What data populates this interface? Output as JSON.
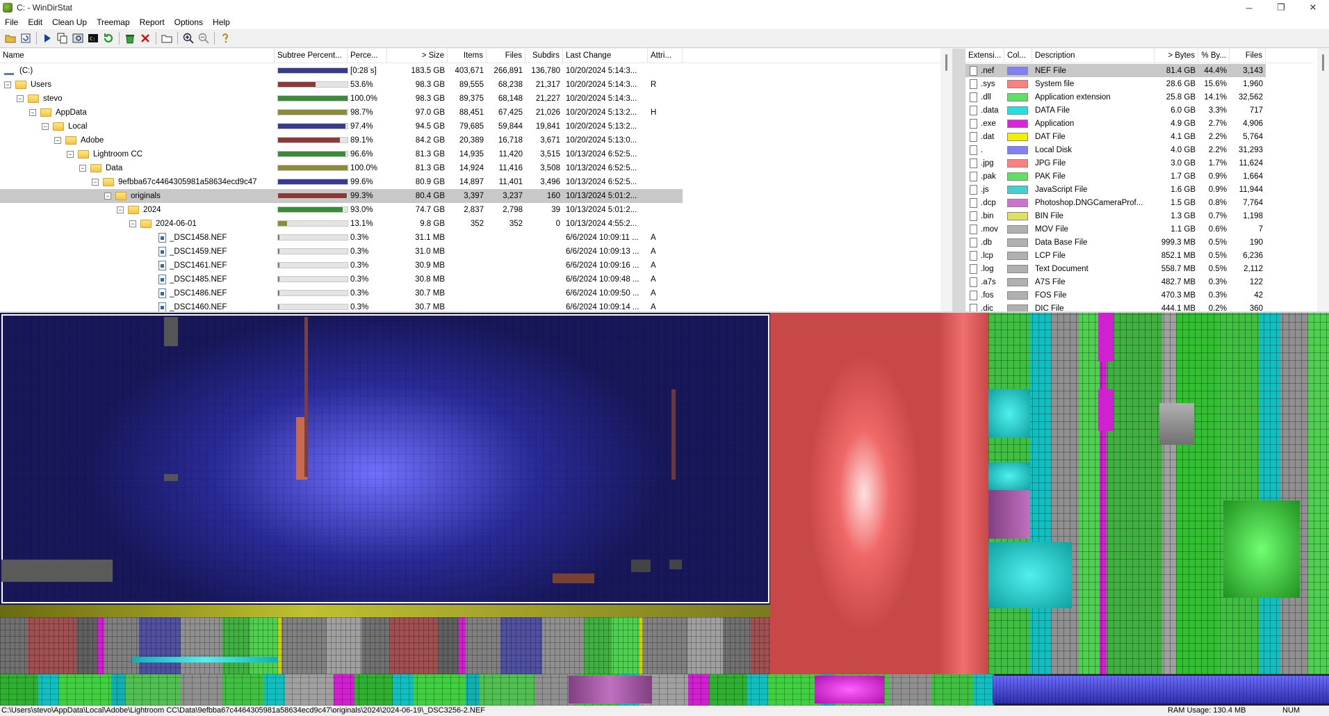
{
  "window": {
    "title": "C: - WinDirStat",
    "min": "─",
    "max": "❐",
    "close": "✕"
  },
  "menu": [
    "File",
    "Edit",
    "Clean Up",
    "Treemap",
    "Report",
    "Options",
    "Help"
  ],
  "toolbar_icons": [
    "open-icon",
    "refresh-icon",
    "play-icon",
    "copy-icon",
    "explorer-icon",
    "cmd-icon",
    "refresh-all-icon",
    "recycle-icon",
    "delete-icon",
    "folder-icon",
    "zoom-in-icon",
    "zoom-out-icon",
    "help-icon"
  ],
  "tree": {
    "headers": [
      "Name",
      "Subtree Percent...",
      "Perce...",
      "> Size",
      "Items",
      "Files",
      "Subdirs",
      "Last Change",
      "Attri..."
    ],
    "rows": [
      {
        "name": "(C:)",
        "depth": 0,
        "icon": "drive",
        "expander": "",
        "pct_fill": 1.0,
        "bar_color": "#3b3b8e",
        "percent": "[0:28 s]",
        "size": "183.5 GB",
        "items": "403,671",
        "files": "266,891",
        "subdirs": "136,780",
        "last_change": "10/20/2024  5:14:3...",
        "attr": ""
      },
      {
        "name": "Users",
        "depth": 0,
        "icon": "folder",
        "expander": "−",
        "pct_fill": 0.536,
        "bar_color": "#8b3a3a",
        "percent": "53.6%",
        "size": "98.3 GB",
        "items": "89,555",
        "files": "68,238",
        "subdirs": "21,317",
        "last_change": "10/20/2024  5:14:3...",
        "attr": "R"
      },
      {
        "name": "stevo",
        "depth": 1,
        "icon": "folder",
        "expander": "−",
        "pct_fill": 1.0,
        "bar_color": "#3a8b3a",
        "percent": "100.0%",
        "size": "98.3 GB",
        "items": "89,375",
        "files": "68,148",
        "subdirs": "21,227",
        "last_change": "10/20/2024  5:14:3...",
        "attr": ""
      },
      {
        "name": "AppData",
        "depth": 2,
        "icon": "folder",
        "expander": "−",
        "pct_fill": 0.987,
        "bar_color": "#8b8b3a",
        "percent": "98.7%",
        "size": "97.0 GB",
        "items": "88,451",
        "files": "67,425",
        "subdirs": "21,026",
        "last_change": "10/20/2024  5:13:2...",
        "attr": "H"
      },
      {
        "name": "Local",
        "depth": 3,
        "icon": "folder",
        "expander": "−",
        "pct_fill": 0.974,
        "bar_color": "#3b3b8e",
        "percent": "97.4%",
        "size": "94.5 GB",
        "items": "79,685",
        "files": "59,844",
        "subdirs": "19,841",
        "last_change": "10/20/2024  5:13:2...",
        "attr": ""
      },
      {
        "name": "Adobe",
        "depth": 4,
        "icon": "folder",
        "expander": "−",
        "pct_fill": 0.891,
        "bar_color": "#8b3a3a",
        "percent": "89.1%",
        "size": "84.2 GB",
        "items": "20,389",
        "files": "16,718",
        "subdirs": "3,671",
        "last_change": "10/20/2024  5:13:0...",
        "attr": ""
      },
      {
        "name": "Lightroom CC",
        "depth": 5,
        "icon": "folder",
        "expander": "−",
        "pct_fill": 0.966,
        "bar_color": "#3a8b3a",
        "percent": "96.6%",
        "size": "81.3 GB",
        "items": "14,935",
        "files": "11,420",
        "subdirs": "3,515",
        "last_change": "10/13/2024  6:52:5...",
        "attr": ""
      },
      {
        "name": "Data",
        "depth": 6,
        "icon": "folder",
        "expander": "−",
        "pct_fill": 1.0,
        "bar_color": "#8b8b3a",
        "percent": "100.0%",
        "size": "81.3 GB",
        "items": "14,924",
        "files": "11,416",
        "subdirs": "3,508",
        "last_change": "10/13/2024  6:52:5...",
        "attr": ""
      },
      {
        "name": "9efbba67c4464305981a58634ecd9c47",
        "depth": 7,
        "icon": "folder",
        "expander": "−",
        "pct_fill": 0.996,
        "bar_color": "#3b3b8e",
        "percent": "99.6%",
        "size": "80.9 GB",
        "items": "14,897",
        "files": "11,401",
        "subdirs": "3,496",
        "last_change": "10/13/2024  6:52:5...",
        "attr": ""
      },
      {
        "name": "originals",
        "depth": 8,
        "icon": "folder",
        "expander": "−",
        "pct_fill": 0.993,
        "bar_color": "#8b3a3a",
        "percent": "99.3%",
        "size": "80.4 GB",
        "items": "3,397",
        "files": "3,237",
        "subdirs": "160",
        "last_change": "10/13/2024  5:01:2...",
        "attr": "",
        "selected": true
      },
      {
        "name": "2024",
        "depth": 9,
        "icon": "folder",
        "expander": "−",
        "pct_fill": 0.93,
        "bar_color": "#3a8b3a",
        "percent": "93.0%",
        "size": "74.7 GB",
        "items": "2,837",
        "files": "2,798",
        "subdirs": "39",
        "last_change": "10/13/2024  5:01:2...",
        "attr": ""
      },
      {
        "name": "2024-06-01",
        "depth": 10,
        "icon": "folder",
        "expander": "−",
        "pct_fill": 0.131,
        "bar_color": "#8b8b3a",
        "percent": "13.1%",
        "size": "9.8 GB",
        "items": "352",
        "files": "352",
        "subdirs": "0",
        "last_change": "10/13/2024  4:55:2...",
        "attr": ""
      },
      {
        "name": "_DSC1458.NEF",
        "depth": 11,
        "icon": "file",
        "expander": "",
        "pct_fill": 0.003,
        "bar_color": "#777",
        "percent": "0.3%",
        "size": "31.1 MB",
        "items": "",
        "files": "",
        "subdirs": "",
        "last_change": "6/6/2024  10:09:11 ...",
        "attr": "A"
      },
      {
        "name": "_DSC1459.NEF",
        "depth": 11,
        "icon": "file",
        "expander": "",
        "pct_fill": 0.003,
        "bar_color": "#777",
        "percent": "0.3%",
        "size": "31.0 MB",
        "items": "",
        "files": "",
        "subdirs": "",
        "last_change": "6/6/2024  10:09:13 ...",
        "attr": "A"
      },
      {
        "name": "_DSC1461.NEF",
        "depth": 11,
        "icon": "file",
        "expander": "",
        "pct_fill": 0.003,
        "bar_color": "#777",
        "percent": "0.3%",
        "size": "30.9 MB",
        "items": "",
        "files": "",
        "subdirs": "",
        "last_change": "6/6/2024  10:09:16 ...",
        "attr": "A"
      },
      {
        "name": "_DSC1485.NEF",
        "depth": 11,
        "icon": "file",
        "expander": "",
        "pct_fill": 0.003,
        "bar_color": "#777",
        "percent": "0.3%",
        "size": "30.8 MB",
        "items": "",
        "files": "",
        "subdirs": "",
        "last_change": "6/6/2024  10:09:48 ...",
        "attr": "A"
      },
      {
        "name": "_DSC1486.NEF",
        "depth": 11,
        "icon": "file",
        "expander": "",
        "pct_fill": 0.003,
        "bar_color": "#777",
        "percent": "0.3%",
        "size": "30.7 MB",
        "items": "",
        "files": "",
        "subdirs": "",
        "last_change": "6/6/2024  10:09:50 ...",
        "attr": "A"
      },
      {
        "name": "_DSC1460.NEF",
        "depth": 11,
        "icon": "file",
        "expander": "",
        "pct_fill": 0.003,
        "bar_color": "#777",
        "percent": "0.3%",
        "size": "30.7 MB",
        "items": "",
        "files": "",
        "subdirs": "",
        "last_change": "6/6/2024  10:09:14 ...",
        "attr": "A"
      }
    ]
  },
  "extensions": {
    "headers": [
      "Extensi...",
      "Col...",
      "Description",
      "> Bytes",
      "% By...",
      "Files"
    ],
    "rows": [
      {
        "ext": ".nef",
        "color": "#8080ff",
        "desc": "NEF File",
        "bytes": "81.4 GB",
        "pct": "44.4%",
        "files": "3,143",
        "selected": true
      },
      {
        "ext": ".sys",
        "color": "#ff8080",
        "desc": "System file",
        "bytes": "28.6 GB",
        "pct": "15.6%",
        "files": "1,960"
      },
      {
        "ext": ".dll",
        "color": "#60e060",
        "desc": "Application extension",
        "bytes": "25.8 GB",
        "pct": "14.1%",
        "files": "32,562"
      },
      {
        "ext": ".data",
        "color": "#20e0e0",
        "desc": "DATA File",
        "bytes": "6.0 GB",
        "pct": "3.3%",
        "files": "717"
      },
      {
        "ext": ".exe",
        "color": "#e020e0",
        "desc": "Application",
        "bytes": "4.9 GB",
        "pct": "2.7%",
        "files": "4,906"
      },
      {
        "ext": ".dat",
        "color": "#f0f000",
        "desc": "DAT File",
        "bytes": "4.1 GB",
        "pct": "2.2%",
        "files": "5,764"
      },
      {
        "ext": ".",
        "color": "#8080ff",
        "desc": "Local Disk",
        "bytes": "4.0 GB",
        "pct": "2.2%",
        "files": "31,293"
      },
      {
        "ext": ".jpg",
        "color": "#ff8080",
        "desc": "JPG File",
        "bytes": "3.0 GB",
        "pct": "1.7%",
        "files": "11,624"
      },
      {
        "ext": ".pak",
        "color": "#60e060",
        "desc": "PAK File",
        "bytes": "1.7 GB",
        "pct": "0.9%",
        "files": "1,664"
      },
      {
        "ext": ".js",
        "color": "#40d0d0",
        "desc": "JavaScript File",
        "bytes": "1.6 GB",
        "pct": "0.9%",
        "files": "11,944"
      },
      {
        "ext": ".dcp",
        "color": "#d070d0",
        "desc": "Photoshop.DNGCameraProf...",
        "bytes": "1.5 GB",
        "pct": "0.8%",
        "files": "7,764"
      },
      {
        "ext": ".bin",
        "color": "#e0e060",
        "desc": "BIN File",
        "bytes": "1.3 GB",
        "pct": "0.7%",
        "files": "1,198"
      },
      {
        "ext": ".mov",
        "color": "#b0b0b0",
        "desc": "MOV File",
        "bytes": "1.1 GB",
        "pct": "0.6%",
        "files": "7"
      },
      {
        "ext": ".db",
        "color": "#b0b0b0",
        "desc": "Data Base File",
        "bytes": "999.3 MB",
        "pct": "0.5%",
        "files": "190"
      },
      {
        "ext": ".lcp",
        "color": "#b0b0b0",
        "desc": "LCP File",
        "bytes": "852.1 MB",
        "pct": "0.5%",
        "files": "6,236"
      },
      {
        "ext": ".log",
        "color": "#b0b0b0",
        "desc": "Text Document",
        "bytes": "558.7 MB",
        "pct": "0.5%",
        "files": "2,112"
      },
      {
        "ext": ".a7s",
        "color": "#b0b0b0",
        "desc": "A7S File",
        "bytes": "482.7 MB",
        "pct": "0.3%",
        "files": "122"
      },
      {
        "ext": ".fos",
        "color": "#b0b0b0",
        "desc": "FOS File",
        "bytes": "470.3 MB",
        "pct": "0.3%",
        "files": "42"
      },
      {
        "ext": ".dic",
        "color": "#b0b0b0",
        "desc": "DIC File",
        "bytes": "444.1 MB",
        "pct": "0.2%",
        "files": "360"
      }
    ]
  },
  "status": {
    "path": "C:\\Users\\stevo\\AppData\\Local\\Adobe\\Lightroom CC\\Data\\9efbba67c4464305981a58634ecd9c47\\originals\\2024\\2024-06-19\\_DSC3256-2.NEF",
    "ram": "RAM Usage:    130.4 MB",
    "num": "NUM"
  }
}
